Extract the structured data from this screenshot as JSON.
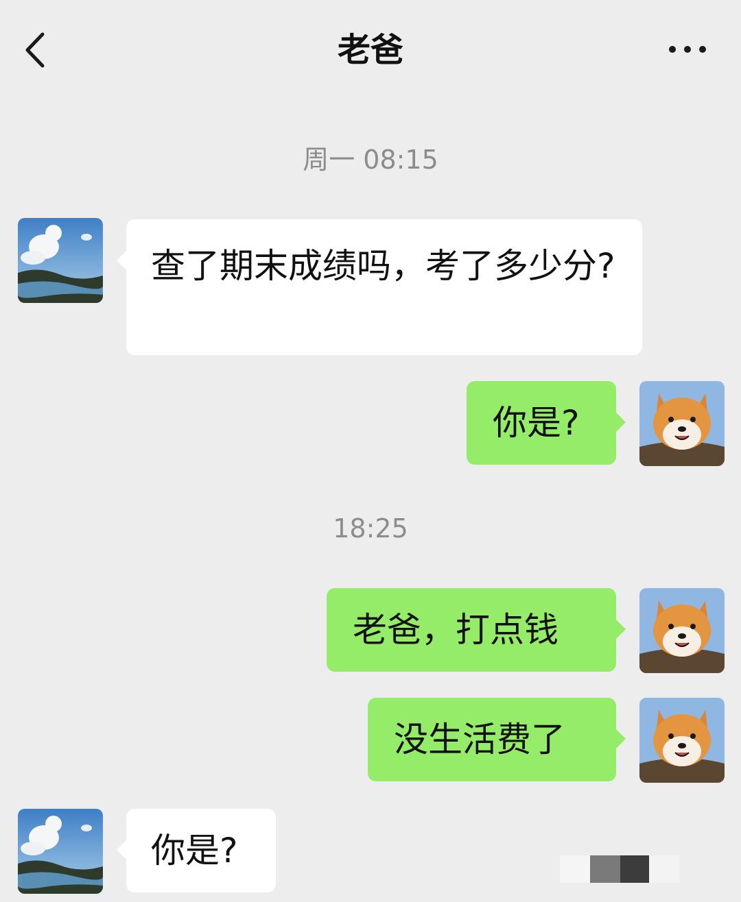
{
  "header": {
    "title": "老爸",
    "back_icon": "chevron-left-icon",
    "more_icon": "more-dots-icon"
  },
  "timestamps": [
    "周一 08:15",
    "18:25"
  ],
  "messages": [
    {
      "from": "contact",
      "text": "查了期末成绩吗，考了多少分?"
    },
    {
      "from": "me",
      "text": "你是?"
    },
    {
      "from": "me",
      "text": "老爸，打点钱"
    },
    {
      "from": "me",
      "text": "没生活费了"
    },
    {
      "from": "contact",
      "text": "你是?"
    }
  ],
  "avatars": {
    "contact": "landscape-lake-avatar",
    "me": "shiba-dog-avatar"
  },
  "colors": {
    "background": "#ededed",
    "my_bubble": "#95ec69",
    "contact_bubble": "#ffffff",
    "timestamp": "#8c8c8c"
  }
}
